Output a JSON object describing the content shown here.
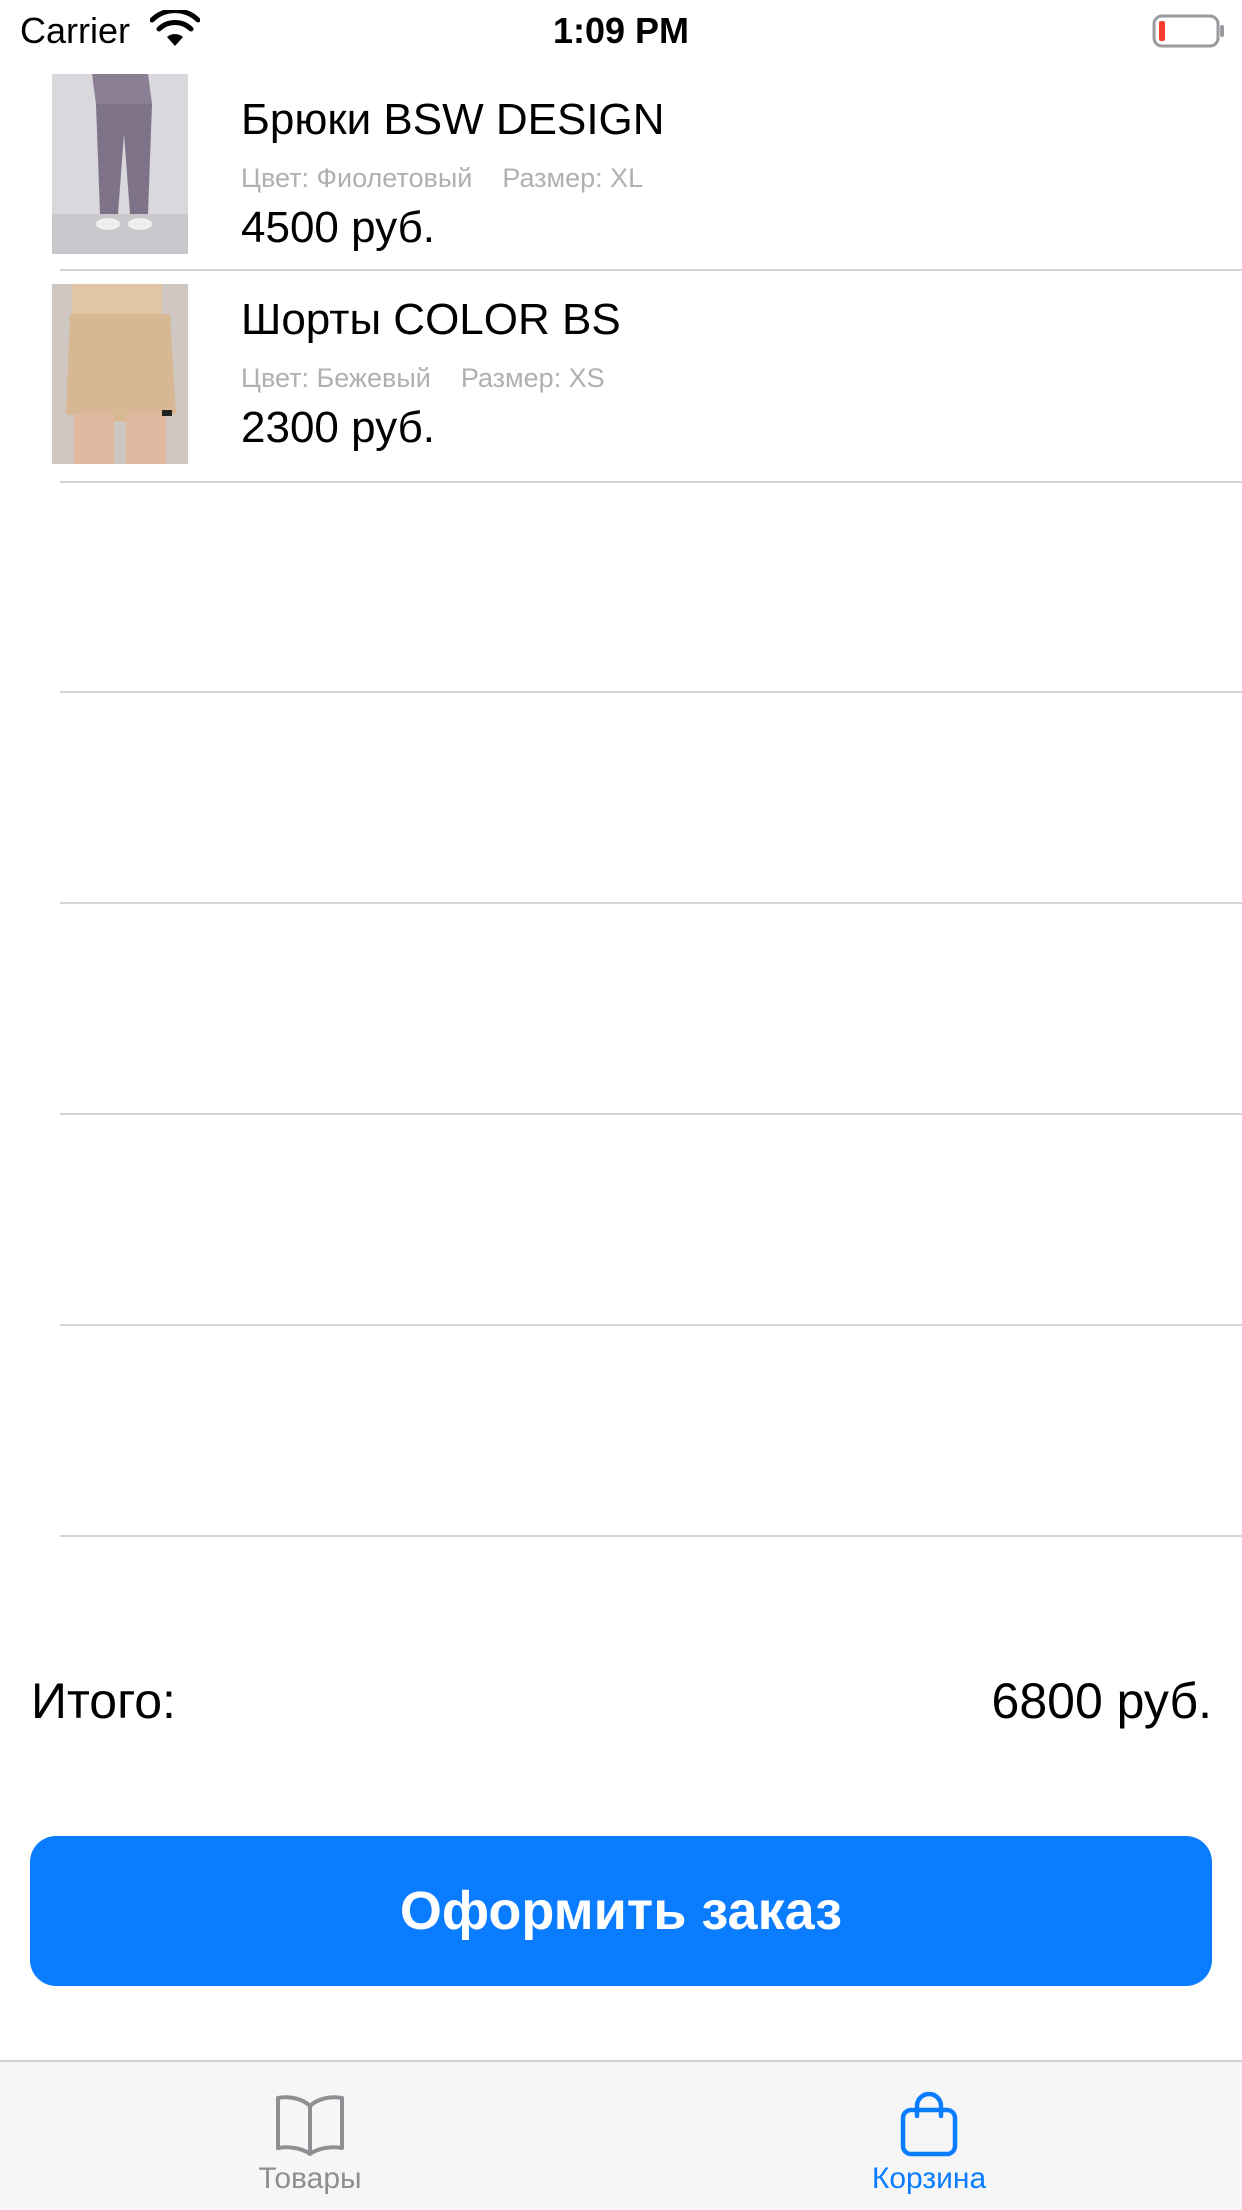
{
  "status_bar": {
    "carrier": "Carrier",
    "time": "1:09 PM",
    "wifi_icon": "wifi-icon",
    "battery_icon": "battery-low-icon"
  },
  "cart": {
    "items": [
      {
        "name": "Брюки BSW DESIGN",
        "color": "Цвет: Фиолетовый",
        "size": "Размер: XL",
        "price": "4500 руб."
      },
      {
        "name": "Шорты COLOR BS",
        "color": "Цвет: Бежевый",
        "size": "Размер: XS",
        "price": "2300 руб."
      }
    ]
  },
  "total": {
    "label": "Итого:",
    "value": "6800 руб."
  },
  "checkout_button": {
    "label": "Оформить заказ",
    "color": "#0a7cff"
  },
  "tab_bar": {
    "tabs": [
      {
        "label": "Товары",
        "icon": "book-icon",
        "active": false,
        "color": "#8e8e93"
      },
      {
        "label": "Корзина",
        "icon": "shopping-bag-icon",
        "active": true,
        "color": "#0a7cff"
      }
    ]
  }
}
